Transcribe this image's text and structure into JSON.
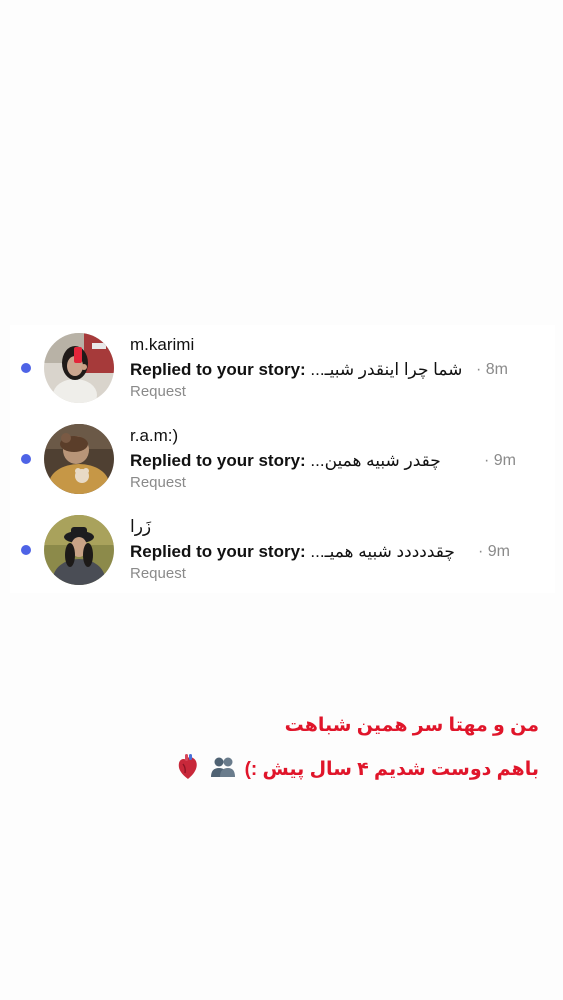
{
  "requests": [
    {
      "username": "m.karimi",
      "prefix": "Replied to your story: ",
      "message": "شما چرا اینقدر شبیـ...",
      "time": "8m",
      "status": "Request",
      "avatar_icon": "profile-photo-girl-red",
      "unread": true
    },
    {
      "username": "r.a.m:)",
      "prefix": "Replied to your story: ",
      "message": "چقدر شبیه همین...",
      "time": "9m",
      "status": "Request",
      "avatar_icon": "profile-photo-teddy-bear",
      "unread": true
    },
    {
      "username": "زَرا",
      "prefix": "Replied to your story: ",
      "message": "چقددددد شبیه همیـ...",
      "time": "9m",
      "status": "Request",
      "avatar_icon": "profile-photo-girl-hat",
      "unread": true
    }
  ],
  "separator": "·",
  "caption": {
    "line1": "من و مهتا سر همین شباهت",
    "line2": "باهم دوست شدیم ۴ سال پیش :)",
    "emoji_1": "two-people-silhouette-emoji",
    "emoji_2": "anatomical-heart-emoji"
  },
  "colors": {
    "unread_dot": "#4e63e6",
    "caption": "#e0152a",
    "meta": "#8a8a8a"
  }
}
